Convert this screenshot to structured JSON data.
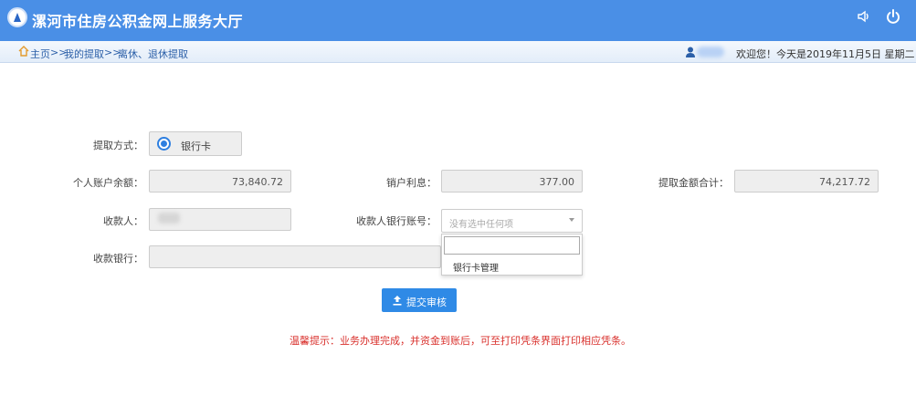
{
  "header": {
    "title": "漯河市住房公积金网上服务大厅",
    "sound_icon": "speaker-icon",
    "power_icon": "power-icon"
  },
  "breadcrumb": {
    "items": [
      "主页",
      "我的提取",
      "离休、退休提取"
    ],
    "separator": ">>"
  },
  "user_bar": {
    "welcome": "欢迎您！今天是2019年11月5日 星期二"
  },
  "form": {
    "method_label": "提取方式：",
    "method_option": "银行卡",
    "balance_label": "个人账户余额：",
    "balance_value": "73,840.72",
    "interest_label": "销户利息：",
    "interest_value": "377.00",
    "total_label": "提取金额合计：",
    "total_value": "74,217.72",
    "payee_label": "收款人：",
    "account_label": "收款人银行账号：",
    "account_placeholder": "没有选中任何项",
    "dropdown_item": "银行卡管理",
    "bank_label": "收款银行：",
    "submit_label": "提交审核"
  },
  "hint": "温馨提示：业务办理完成，并资金到账后，可至打印凭条界面打印相应凭条。",
  "colors": {
    "header_bg": "#4a8fe6",
    "accent": "#2f8ae6",
    "hint": "#d9302c"
  }
}
